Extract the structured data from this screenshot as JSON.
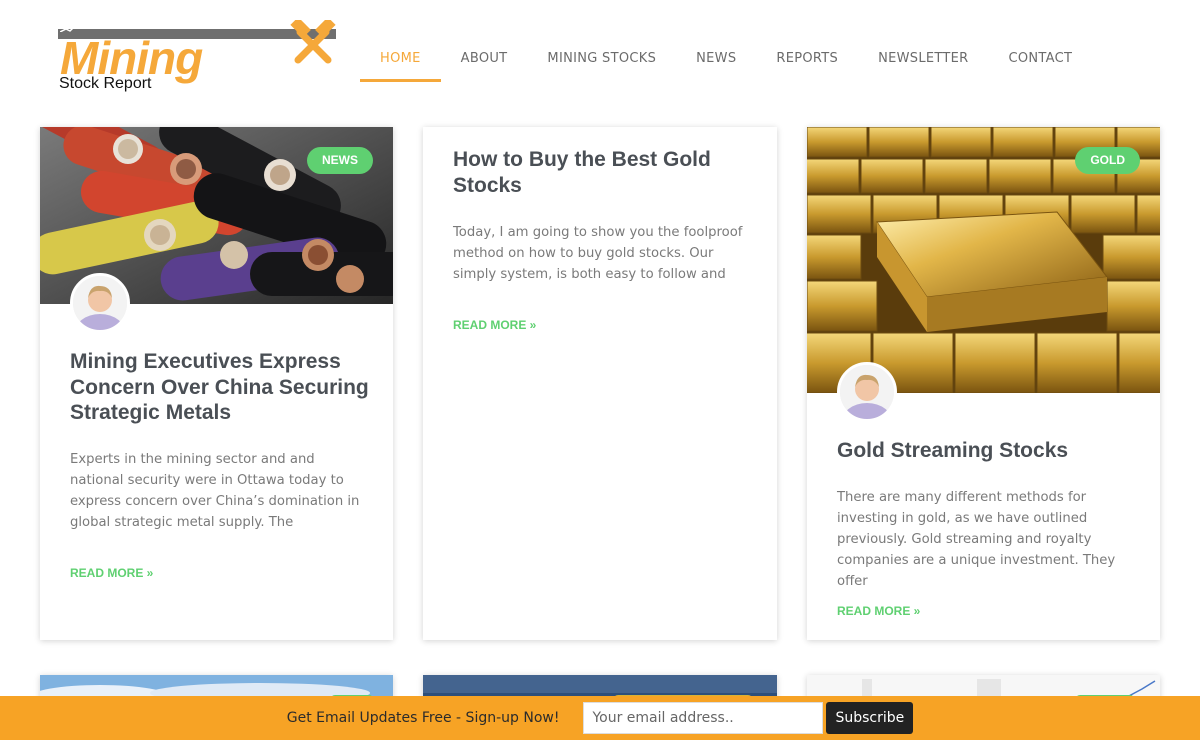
{
  "brand": {
    "word": "Mining",
    "sub": "Stock Report",
    "accent": "#f5a83a",
    "green": "#5fd071"
  },
  "nav": [
    {
      "label": "Home",
      "active": true
    },
    {
      "label": "About"
    },
    {
      "label": "Mining Stocks"
    },
    {
      "label": "News"
    },
    {
      "label": "Reports"
    },
    {
      "label": "Newsletter"
    },
    {
      "label": "Contact"
    }
  ],
  "posts": [
    {
      "badge": "News",
      "title": "Mining Executives Express Concern Over China Securing Strategic Metals",
      "excerpt": "Experts in the mining sector and and national security were in Ottawa today to express concern over China’s domination in global strategic metal supply. The",
      "read_more": "Read More »"
    },
    {
      "title": "How to Buy the Best Gold Stocks",
      "excerpt": "Today, I am going to show you the foolproof method on how to buy gold stocks. Our simply system, is both easy to follow and",
      "read_more": "Read More »"
    },
    {
      "badge": "Gold",
      "title": "Gold Streaming Stocks",
      "excerpt": "There are many different methods for investing in gold, as we have outlined previously. Gold streaming and royalty companies are a unique investment. They offer",
      "read_more": "Read More »"
    }
  ],
  "signup": {
    "text": "Get Email Updates Free - Sign-up Now!",
    "placeholder": "Your email address..",
    "button": "Subscribe",
    "bar_color": "#f7a325"
  }
}
